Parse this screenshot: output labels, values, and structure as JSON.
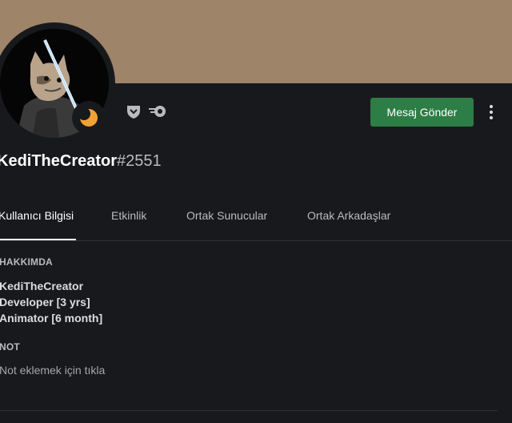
{
  "profile": {
    "username": "KediTheCreator",
    "discriminator": "#2551",
    "avatar_icon": "cat-avatar-icon",
    "status_icon": "moon-idle-icon",
    "badges": [
      "hypesquad-badge-icon",
      "nitro-boost-badge-icon"
    ],
    "banner_color": "#9e8469",
    "status_color": "#f0a232"
  },
  "actions": {
    "message_button": "Mesaj Gönder",
    "more_icon": "more-vertical-icon",
    "button_color": "#2d7d46"
  },
  "tabs": [
    {
      "label": "Kullanıcı Bilgisi",
      "active": true
    },
    {
      "label": "Etkinlik",
      "active": false
    },
    {
      "label": "Ortak Sunucular",
      "active": false
    },
    {
      "label": "Ortak Arkadaşlar",
      "active": false
    }
  ],
  "about": {
    "title": "HAKKIMDA",
    "lines": [
      "KediTheCreator",
      "Developer [3 yrs]",
      "Animator [6 month]"
    ]
  },
  "note": {
    "title": "NOT",
    "placeholder": "Not eklemek için tıkla"
  }
}
